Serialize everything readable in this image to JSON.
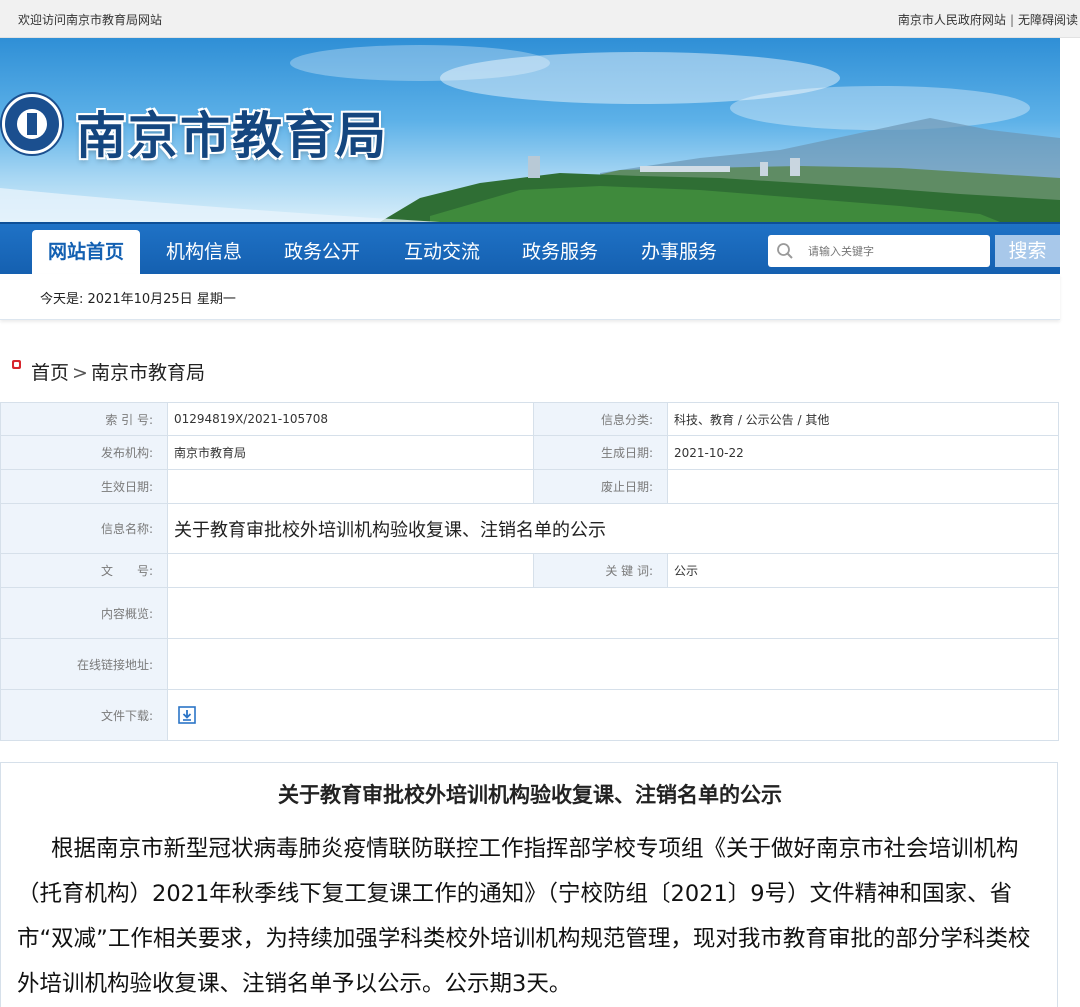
{
  "topbar": {
    "welcome": "欢迎访问南京市教育局网站",
    "gov_link": "南京市人民政府网站",
    "separator": "|",
    "accessibility_link": "无障碍阅读"
  },
  "banner": {
    "site_title": "南京市教育局"
  },
  "nav": {
    "items": [
      {
        "label": "网站首页"
      },
      {
        "label": "机构信息"
      },
      {
        "label": "政务公开"
      },
      {
        "label": "互动交流"
      },
      {
        "label": "政务服务"
      },
      {
        "label": "办事服务"
      }
    ],
    "search_placeholder": "请输入关键字",
    "search_button": "搜索"
  },
  "datebar": {
    "text": "今天是: 2021年10月25日 星期一"
  },
  "breadcrumb": {
    "home": "首页",
    "sep": ">",
    "current": "南京市教育局"
  },
  "meta": {
    "index_label": "索 引 号:",
    "index_value": "01294819X/2021-105708",
    "category_label": "信息分类:",
    "category_value": "科技、教育 / 公示公告 / 其他",
    "publisher_label": "发布机构:",
    "publisher_value": "南京市教育局",
    "created_label": "生成日期:",
    "created_value": "2021-10-22",
    "effective_label": "生效日期:",
    "effective_value": "",
    "expiry_label": "废止日期:",
    "expiry_value": "",
    "name_label": "信息名称:",
    "name_value": "关于教育审批校外培训机构验收复课、注销名单的公示",
    "docno_label": "文　　号:",
    "docno_value": "",
    "keywords_label": "关 键 词:",
    "keywords_value": "公示",
    "summary_label": "内容概览:",
    "summary_value": "",
    "link_label": "在线链接地址:",
    "link_value": "",
    "download_label": "文件下载:"
  },
  "article": {
    "title": "关于教育审批校外培训机构验收复课、注销名单的公示",
    "body": "根据南京市新型冠状病毒肺炎疫情联防联控工作指挥部学校专项组《关于做好南京市社会培训机构（托育机构）2021年秋季线下复工复课工作的通知》（宁校防组〔2021〕9号）文件精神和国家、省市“双减”工作相关要求，为持续加强学科类校外培训机构规范管理，现对我市教育审批的部分学科类校外培训机构验收复课、注销名单予以公示。公示期3天。"
  },
  "colors": {
    "nav_blue": "#1560b0",
    "title_blue": "#14467f",
    "label_bg": "#eef4fb",
    "bullet_red": "#d7262e"
  },
  "icons": [
    "search-icon",
    "download-icon",
    "emblem-logo"
  ]
}
